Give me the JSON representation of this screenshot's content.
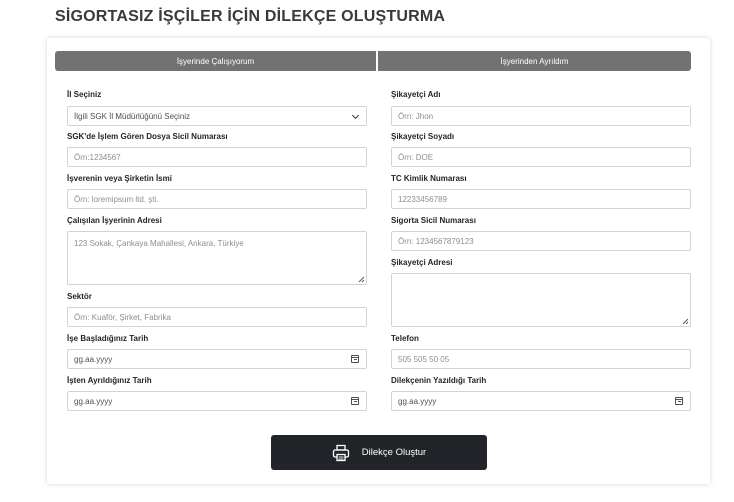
{
  "page": {
    "title": "SİGORTASIZ İŞÇİLER İÇİN DİLEKÇE OLUŞTURMA"
  },
  "tabs": [
    {
      "label": "İşyerinde Çalışıyorum"
    },
    {
      "label": "İşyerinden Ayrıldım"
    }
  ],
  "left": {
    "il": {
      "label": "İl Seçiniz",
      "value": "İlgili SGK İl Müdürlüğünü Seçiniz"
    },
    "sicil": {
      "label": "SGK'de İşlem Gören Dosya Sicil Numarası",
      "placeholder": "Örn:1234567"
    },
    "isveren": {
      "label": "İşverenin veya Şirketin İsmi",
      "placeholder": "Örn: loremipsum ltd. şti."
    },
    "adres": {
      "label": "Çalışılan İşyerinin Adresi",
      "placeholder": "123 Sokak, Çankaya Mahallesi, Ankara, Türkiye"
    },
    "sektor": {
      "label": "Sektör",
      "placeholder": "Örn: Kuaför, Şirket, Fabrika"
    },
    "baslama": {
      "label": "İşe Başladığınız Tarih",
      "placeholder": "gg.aa.yyyy"
    },
    "ayrilma": {
      "label": "İşten Ayrıldığınız Tarih",
      "placeholder": "gg.aa.yyyy"
    }
  },
  "right": {
    "ad": {
      "label": "Şikayetçi Adı",
      "placeholder": "Örn: Jhon"
    },
    "soyad": {
      "label": "Şikayetçi Soyadı",
      "placeholder": "Örn: DOE"
    },
    "tc": {
      "label": "TC Kimlik Numarası",
      "placeholder": "12233456789"
    },
    "sigorta": {
      "label": "Sigorta Sicil Numarası",
      "placeholder": "Örn: 1234567879123"
    },
    "adres": {
      "label": "Şikayetçi Adresi",
      "placeholder": ""
    },
    "telefon": {
      "label": "Telefon",
      "placeholder": "505 505 50 05"
    },
    "tarih": {
      "label": "Dilekçenin Yazıldığı Tarih",
      "placeholder": "gg.aa.yyyy"
    }
  },
  "submit": {
    "label": "Dilekçe Oluştur",
    "icon": "printer-icon"
  }
}
